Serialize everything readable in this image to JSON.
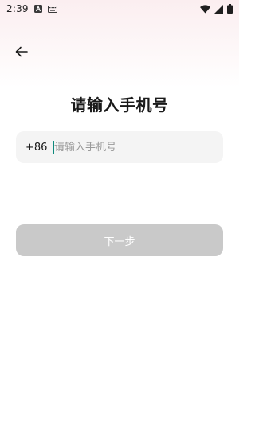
{
  "status_bar": {
    "time": "2:39",
    "icons": [
      "notification-a-icon",
      "keyboard-icon",
      "wifi-icon",
      "cellular-signal-icon",
      "battery-icon"
    ]
  },
  "navigation": {
    "back_icon": "arrow-left-icon"
  },
  "title": "请输入手机号",
  "phone_input": {
    "country_code": "+86",
    "value": "",
    "placeholder": "请输入手机号"
  },
  "next_button": {
    "label": "下一步",
    "state": "disabled"
  },
  "colors": {
    "caret": "#0f8a7d",
    "button_disabled": "#c9c9c9",
    "input_background": "#f4f4f4",
    "header_tint": "#fbeef0"
  }
}
